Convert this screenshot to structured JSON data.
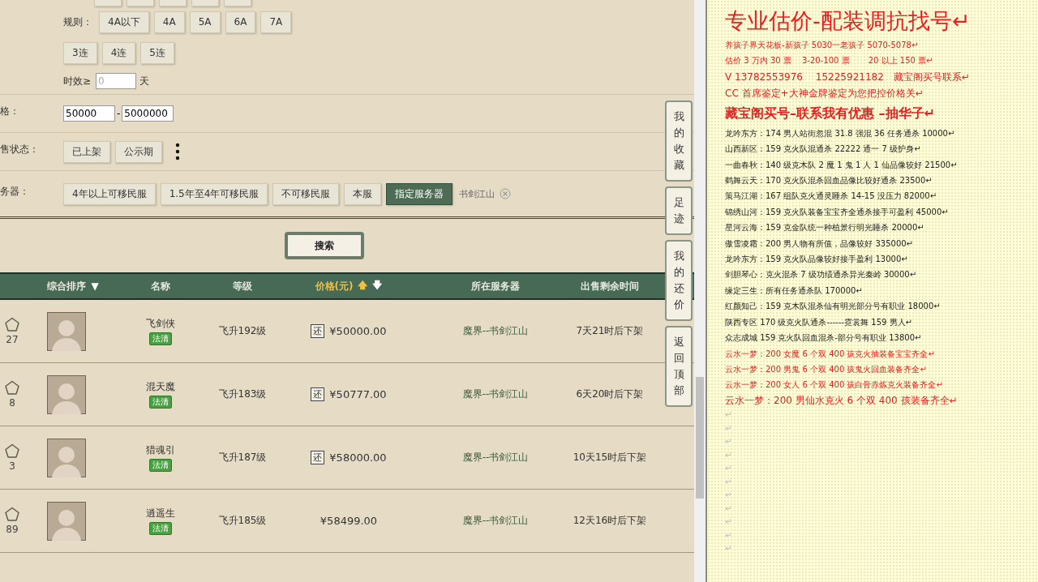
{
  "filters": {
    "top_buttons": [
      {
        "selected": false
      },
      {
        "selected": false
      },
      {
        "selected": false
      },
      {
        "selected": false
      },
      {
        "selected": false
      }
    ],
    "rule": {
      "label": "规则：",
      "options": [
        {
          "label": "4A以下",
          "selected": false
        },
        {
          "label": "4A",
          "selected": false
        },
        {
          "label": "5A",
          "selected": false
        },
        {
          "label": "6A",
          "selected": false
        },
        {
          "label": "7A",
          "selected": false
        }
      ]
    },
    "combo": {
      "options": [
        {
          "label": "3连",
          "selected": false
        },
        {
          "label": "4连",
          "selected": false
        },
        {
          "label": "5连",
          "selected": false
        }
      ]
    },
    "validity": {
      "label": "时效≥",
      "placeholder": "0",
      "unit": "天"
    },
    "price": {
      "label": "格：",
      "min": "50000",
      "separator": "-",
      "max": "5000000"
    },
    "status": {
      "label": "售状态：",
      "options": [
        {
          "label": "已上架",
          "selected": false
        },
        {
          "label": "公示期",
          "selected": false
        }
      ]
    },
    "server": {
      "label": "务器：",
      "options": [
        {
          "label": "4年以上可移民服",
          "selected": false
        },
        {
          "label": "1.5年至4年可移民服",
          "selected": false
        },
        {
          "label": "不可移民服",
          "selected": false
        },
        {
          "label": "本服",
          "selected": false
        },
        {
          "label": "指定服务器",
          "selected": true
        }
      ],
      "chosen": "书剑江山"
    }
  },
  "search_button": "搜索",
  "table": {
    "columns": [
      {
        "label": "综合排序",
        "sort_marks": [
          "▼"
        ],
        "selected": false
      },
      {
        "label": "名称"
      },
      {
        "label": "等级"
      },
      {
        "label": "价格(元)",
        "sort_marks": [
          "🡅",
          "🡇"
        ],
        "selected": true
      },
      {
        "label": "所在服务器"
      },
      {
        "label": "出售剩余时间"
      }
    ],
    "rows": [
      {
        "favorites": "27",
        "name": "飞剑侠",
        "tag": "法清",
        "level": "飞升192级",
        "bargain": true,
        "bargain_label": "还",
        "price": "¥50000.00",
        "server": "魔界--书剑江山",
        "time_left": "7天21时后下架"
      },
      {
        "favorites": "8",
        "name": "混天魔",
        "tag": "法清",
        "level": "飞升183级",
        "bargain": true,
        "bargain_label": "还",
        "price": "¥50777.00",
        "server": "魔界--书剑江山",
        "time_left": "6天20时后下架"
      },
      {
        "favorites": "3",
        "name": "猎魂引",
        "tag": "法清",
        "level": "飞升187级",
        "bargain": true,
        "bargain_label": "还",
        "price": "¥58000.00",
        "server": "魔界--书剑江山",
        "time_left": "10天15时后下架"
      },
      {
        "favorites": "89",
        "name": "逍遥生",
        "tag": "法清",
        "level": "飞升185级",
        "bargain": false,
        "price": "¥58499.00",
        "server": "魔界--书剑江山",
        "time_left": "12天16时后下架"
      }
    ]
  },
  "side_tabs": [
    "我的收藏",
    "足迹",
    "我的还价",
    "返回顶部"
  ],
  "document": {
    "lines": [
      {
        "kind": "title",
        "text": "专业估价-配装调抗找号↵"
      },
      {
        "kind": "red",
        "text": "养孩子界天花板-新孩子 5030一老孩子 5070-5078↵"
      },
      {
        "kind": "red",
        "text": "估价 3 万内 30 票　 3-20-100 票　　 20 以上 150 票↵"
      },
      {
        "kind": "red-mid",
        "text": "V 13782553976　 15225921182　藏宝阁买号联系↵"
      },
      {
        "kind": "red-mid",
        "text": "CC 首席鉴定+大神金牌鉴定为您把控价格关↵"
      },
      {
        "kind": "red-bold",
        "text": "藏宝阁买号–联系我有优惠 –抽华子↵"
      },
      {
        "kind": "black",
        "text": "龙吟东方：174 男人站街忽混 31.8 强混 36 任务通杀 10000↵"
      },
      {
        "kind": "black",
        "text": "山西新区：159 克火队混通杀 22222 通一 7 级护身↵"
      },
      {
        "kind": "black",
        "text": "一曲春秋：140 级克木队 2 魔 1 鬼 1 人 1 仙品像较好 21500↵"
      },
      {
        "kind": "black",
        "text": "鹤舞云天：170 克火队混杀回血品像比较好通杀 23500↵"
      },
      {
        "kind": "black",
        "text": "策马江湖：167 组队克火通灵睡杀 14-15 没压力 82000↵"
      },
      {
        "kind": "black",
        "text": "锦绣山河：159 克火队装备宝宝齐全通杀接手可盈利 45000↵"
      },
      {
        "kind": "black",
        "text": "星河云海：159 克金队统一种植景行明光睡杀 20000↵"
      },
      {
        "kind": "black",
        "text": "傲雪凌霜：200 男人物有所值，品像较好 335000↵"
      },
      {
        "kind": "black",
        "text": "龙吟东方：159 克火队品像较好接手盈利 13000↵"
      },
      {
        "kind": "black",
        "text": "剑胆琴心：克火混杀 7 级功绩通杀异光秦岭 30000↵"
      },
      {
        "kind": "black",
        "text": "缘定三生：所有任务通杀队 170000↵"
      },
      {
        "kind": "black",
        "text": "红颜知己：159 克木队混杀仙有明光部分号有职业 18000↵"
      },
      {
        "kind": "black",
        "text": "陕西专区 170 级克火队通杀------霓裳舞 159 男人↵"
      },
      {
        "kind": "black",
        "text": "众志成城 159 克火队回血混杀-部分号有职业 13800↵"
      },
      {
        "kind": "red",
        "text": "云水一梦：200 女魔 6 个双 400 孩克火抽装备宝宝齐全↵"
      },
      {
        "kind": "red",
        "text": "云水一梦：200 男鬼 6 个双 400 孩鬼火回血装备齐全↵"
      },
      {
        "kind": "red",
        "text": "云水一梦：200 女人 6 个双 400 孩白骨赤炼克火装备齐全↵"
      },
      {
        "kind": "red-large",
        "text": "云水一梦：200 男仙水克火 6 个双 400 孩装备齐全↵"
      },
      {
        "kind": "empty",
        "text": "↵"
      },
      {
        "kind": "empty",
        "text": "↵"
      },
      {
        "kind": "empty",
        "text": "↵"
      },
      {
        "kind": "empty",
        "text": "↵"
      },
      {
        "kind": "empty",
        "text": "↵"
      },
      {
        "kind": "empty",
        "text": "↵"
      },
      {
        "kind": "empty",
        "text": "↵"
      },
      {
        "kind": "empty",
        "text": "↵"
      },
      {
        "kind": "empty",
        "text": "↵"
      },
      {
        "kind": "empty",
        "text": "↵"
      },
      {
        "kind": "empty",
        "text": "↵"
      }
    ]
  }
}
